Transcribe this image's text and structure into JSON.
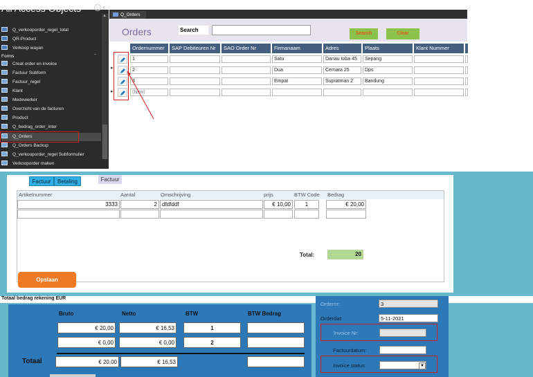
{
  "nav": {
    "title": "All Access Objects",
    "items": [
      {
        "label": "Q_verkooporder_regel_total",
        "kind": "q"
      },
      {
        "label": "QR-Product",
        "kind": "q"
      },
      {
        "label": "Verkoop wayan",
        "kind": "q"
      }
    ],
    "forms_group": "Forms",
    "forms": [
      {
        "label": "Creat order en invoice"
      },
      {
        "label": "Factuur Subform"
      },
      {
        "label": "Factuur_regel"
      },
      {
        "label": "Klant"
      },
      {
        "label": "Medewerker"
      },
      {
        "label": "Overzicht van de facturen"
      },
      {
        "label": "Product"
      },
      {
        "label": "Q_bedrag_order_inter"
      },
      {
        "label": "Q_Orders"
      },
      {
        "label": "Q_Orders Backup"
      },
      {
        "label": "Q_verkooporder_regel Subformulier"
      },
      {
        "label": "Verkooporder maken"
      }
    ]
  },
  "orders": {
    "tab": "Q_Orders",
    "title": "Orders",
    "search_label": "Search",
    "search_button": "Search",
    "clear_button": "Clear",
    "columns": [
      "Ordernummer",
      "SAP Debiteuren Nr",
      "SAO Order Nr",
      "Firmanaam",
      "Adres",
      "Plaats",
      "Klant Nummer"
    ],
    "rows": [
      {
        "ordernummer": "1",
        "sap": "",
        "sao": "",
        "firmanaam": "Satu",
        "adres": "Danau toba 45",
        "plaats": "Sepang",
        "klant": ""
      },
      {
        "ordernummer": "2",
        "sap": "",
        "sao": "",
        "firmanaam": "Dua",
        "adres": "Cemara 25",
        "plaats": "Dps",
        "klant": ""
      },
      {
        "ordernummer": "3",
        "sap": "",
        "sao": "",
        "firmanaam": "Empat",
        "adres": "Supratman 2",
        "plaats": "Bandung",
        "klant": ""
      },
      {
        "ordernummer": "(New)",
        "sap": "",
        "sao": "",
        "firmanaam": "",
        "adres": "",
        "plaats": "",
        "klant": ""
      }
    ]
  },
  "factuur": {
    "tabs": [
      "Factuur",
      "Betaling"
    ],
    "tab_extra": "Factuur",
    "headers": [
      "Artikelnummer",
      "Aantal",
      "Omschrijving",
      "prijs",
      "BTW Code",
      "Bedrag"
    ],
    "line": {
      "artikelnummer": "3333",
      "aantal": "2",
      "omschrijving": "dfdfddf",
      "prijs": "€ 10,00",
      "btw_code": "1",
      "bedrag": "€ 20,00"
    },
    "total_label": "Total:",
    "total_value": "20",
    "save_button": "Opslaan"
  },
  "totaal": {
    "title": "Totaal bedrag rekening EUR",
    "headers": [
      "Bruto",
      "Netto",
      "BTW",
      "BTW Bedrag"
    ],
    "rows": [
      {
        "bruto": "€ 20,00",
        "netto": "€ 16,53",
        "btw": "1",
        "btw_bedrag": ""
      },
      {
        "bruto": "€ 0,00",
        "netto": "€ 0,00",
        "btw": "2",
        "btw_bedrag": ""
      }
    ],
    "sum_label": "Totaal",
    "sum": {
      "bruto": "€ 20,00",
      "netto": "€ 16,53",
      "btw_bedrag": ""
    }
  },
  "invoice": {
    "ordernr_label": "Ordernr:",
    "ordernr": "3",
    "orderdat_label": "Orderdat:",
    "orderdat": "5-11-2021",
    "invoice_nr_label": "Invoice Nr:",
    "invoice_nr": "",
    "factuurdatum_label": "Factuurdatum:",
    "factuurdatum": "",
    "status_label": "Invoice status:",
    "status": ""
  },
  "colors": {
    "accent": "#45607e",
    "button_green": "#8bc34a",
    "save_orange": "#f07a24",
    "panel": "#67b9cc",
    "highlight": "#d02020"
  }
}
